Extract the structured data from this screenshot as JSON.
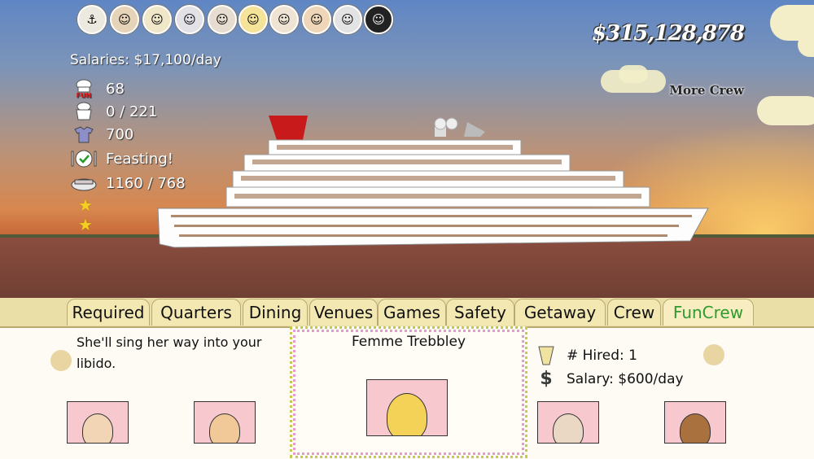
{
  "money": "$315,128,878",
  "more_crew": "More Crew",
  "salaries": "Salaries: $17,100/day",
  "stats": [
    {
      "icon": "fun-chef-hat-icon",
      "value": "68"
    },
    {
      "icon": "crew-shirt-icon",
      "value": "0 / 221"
    },
    {
      "icon": "uniform-shirt-icon",
      "value": "700"
    },
    {
      "icon": "dining-plate-icon",
      "value": "Feasting!"
    },
    {
      "icon": "lifeboat-icon",
      "value": "1160 / 768"
    }
  ],
  "stars": 2,
  "crew_portraits": [
    "captain-face-icon",
    "officer-face-icon",
    "crew-face-icon",
    "diva-face-icon",
    "chef-face-icon",
    "blonde-face-icon",
    "hostess-face-icon",
    "cook-face-icon",
    "elder-face-icon",
    "afro-face-icon"
  ],
  "tabs": [
    {
      "label": "Required",
      "active": false
    },
    {
      "label": "Quarters",
      "active": false
    },
    {
      "label": "Dining",
      "active": false
    },
    {
      "label": "Venues",
      "active": false
    },
    {
      "label": "Games",
      "active": false
    },
    {
      "label": "Safety",
      "active": false
    },
    {
      "label": "Getaway",
      "active": false
    },
    {
      "label": "Crew",
      "active": false
    },
    {
      "label": "FunCrew",
      "active": true
    }
  ],
  "panel": {
    "description": "She'll sing her way into your libido.",
    "selected_name": "Femme Trebbley",
    "hired_label": "# Hired: 1",
    "salary_label": "Salary: $600/day"
  },
  "colors": {
    "active_tab": "#2f9a2f",
    "card_bg": "#f7c9cf",
    "money": "#ffffff"
  }
}
